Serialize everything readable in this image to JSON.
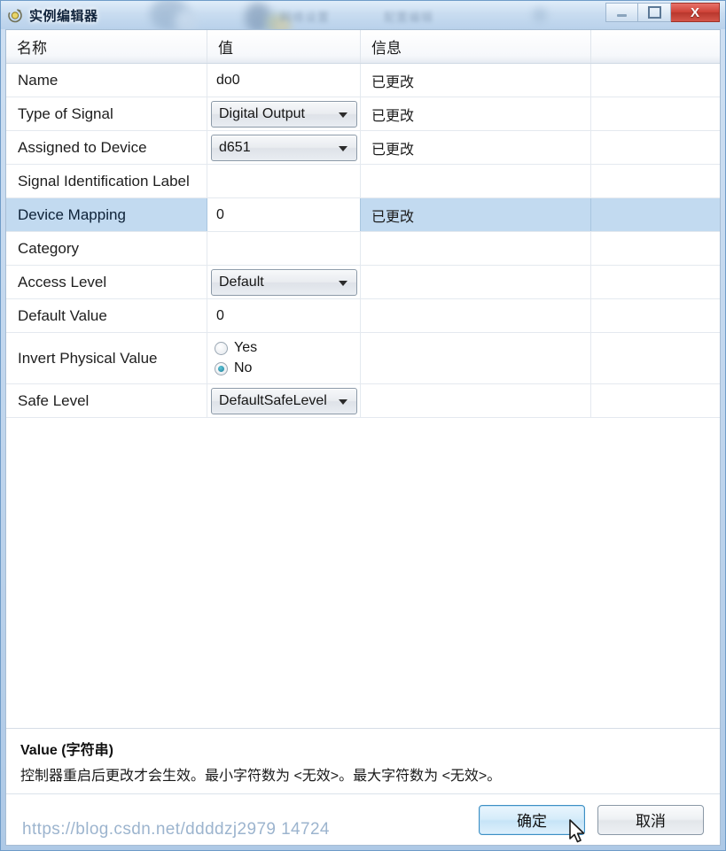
{
  "window": {
    "title": "实例编辑器",
    "icon": "instance-editor-icon",
    "controls": {
      "minimize": "",
      "maximize": "",
      "close": "X"
    },
    "glass_blur_text_1": "网络设置",
    "glass_blur_text_2": "配置编辑"
  },
  "grid": {
    "columns": [
      "名称",
      "值",
      "信息"
    ],
    "rows": [
      {
        "name": "Name",
        "editor": "text",
        "value": "do0",
        "info": "已更改",
        "selected": false
      },
      {
        "name": "Type of Signal",
        "editor": "combo",
        "value": "Digital Output",
        "info": "已更改",
        "selected": false
      },
      {
        "name": "Assigned to Device",
        "editor": "combo",
        "value": "d651",
        "info": "已更改",
        "selected": false
      },
      {
        "name": "Signal Identification Label",
        "editor": "text",
        "value": "",
        "info": "",
        "selected": false
      },
      {
        "name": "Device Mapping",
        "editor": "text",
        "value": "0",
        "info": "已更改",
        "selected": true
      },
      {
        "name": "Category",
        "editor": "text",
        "value": "",
        "info": "",
        "selected": false
      },
      {
        "name": "Access Level",
        "editor": "combo",
        "value": "Default",
        "info": "",
        "selected": false
      },
      {
        "name": "Default Value",
        "editor": "text",
        "value": "0",
        "info": "",
        "selected": false
      },
      {
        "name": "Invert Physical Value",
        "editor": "radio",
        "value": "No",
        "info": "",
        "selected": false,
        "options": [
          {
            "label": "Yes",
            "checked": false
          },
          {
            "label": "No",
            "checked": true
          }
        ]
      },
      {
        "name": "Safe Level",
        "editor": "combo",
        "value": "DefaultSafeLevel",
        "info": "",
        "selected": false
      }
    ]
  },
  "help": {
    "title": "Value (字符串)",
    "body": "控制器重启后更改才会生效。最小字符数为 <无效>。最大字符数为 <无效>。"
  },
  "buttons": {
    "ok": "确定",
    "cancel": "取消"
  },
  "watermark": "https://blog.csdn.net/ddddzj2979 14724",
  "colors": {
    "selection": "#c2daf0",
    "close_button": "#cf4338",
    "default_button_border": "#3d8fc4",
    "radio_on": "#1c7f97"
  }
}
